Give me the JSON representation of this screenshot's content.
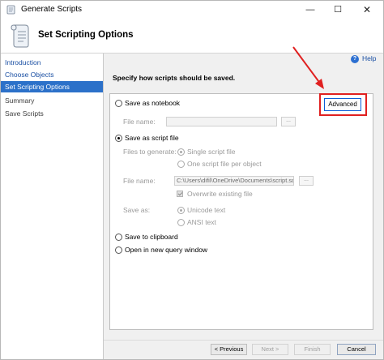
{
  "window": {
    "title": "Generate Scripts",
    "minimize_glyph": "—",
    "maximize_glyph": "☐",
    "close_glyph": "✕"
  },
  "header": {
    "title": "Set Scripting Options",
    "icon": "scroll-icon"
  },
  "nav": {
    "items": [
      {
        "label": "Introduction",
        "state": "link"
      },
      {
        "label": "Choose Objects",
        "state": "link"
      },
      {
        "label": "Set Scripting Options",
        "state": "active"
      },
      {
        "label": "Summary",
        "state": "plain"
      },
      {
        "label": "Save Scripts",
        "state": "plain"
      }
    ]
  },
  "help": {
    "label": "Help",
    "icon_glyph": "?"
  },
  "instruction": "Specify how scripts should be saved.",
  "options": {
    "save_as_notebook": {
      "label": "Save as notebook",
      "selected": false,
      "file_name_label": "File name:",
      "file_name_value": "",
      "browse_label": "..."
    },
    "save_as_script_file": {
      "label": "Save as script file",
      "selected": true,
      "files_to_generate_label": "Files to generate:",
      "single_script_label": "Single script file",
      "one_script_per_object_label": "One script file per object",
      "single_selected": true,
      "file_name_label": "File name:",
      "file_name_value": "C:\\Users\\difil\\OneDrive\\Documents\\script.sql",
      "browse_label": "...",
      "overwrite_label": "Overwrite existing file",
      "overwrite_checked": true,
      "save_as_label": "Save as:",
      "unicode_label": "Unicode text",
      "ansi_label": "ANSI text",
      "unicode_selected": true
    },
    "save_to_clipboard": {
      "label": "Save to clipboard",
      "selected": false
    },
    "open_in_query_window": {
      "label": "Open in new query window",
      "selected": false
    }
  },
  "advanced_button": {
    "label": "Advanced"
  },
  "footer": {
    "previous": "< Previous",
    "next": "Next >",
    "finish": "Finish",
    "cancel": "Cancel"
  },
  "colors": {
    "accent": "#2c71c9",
    "link": "#1a4fa3",
    "highlight": "#e02020"
  }
}
